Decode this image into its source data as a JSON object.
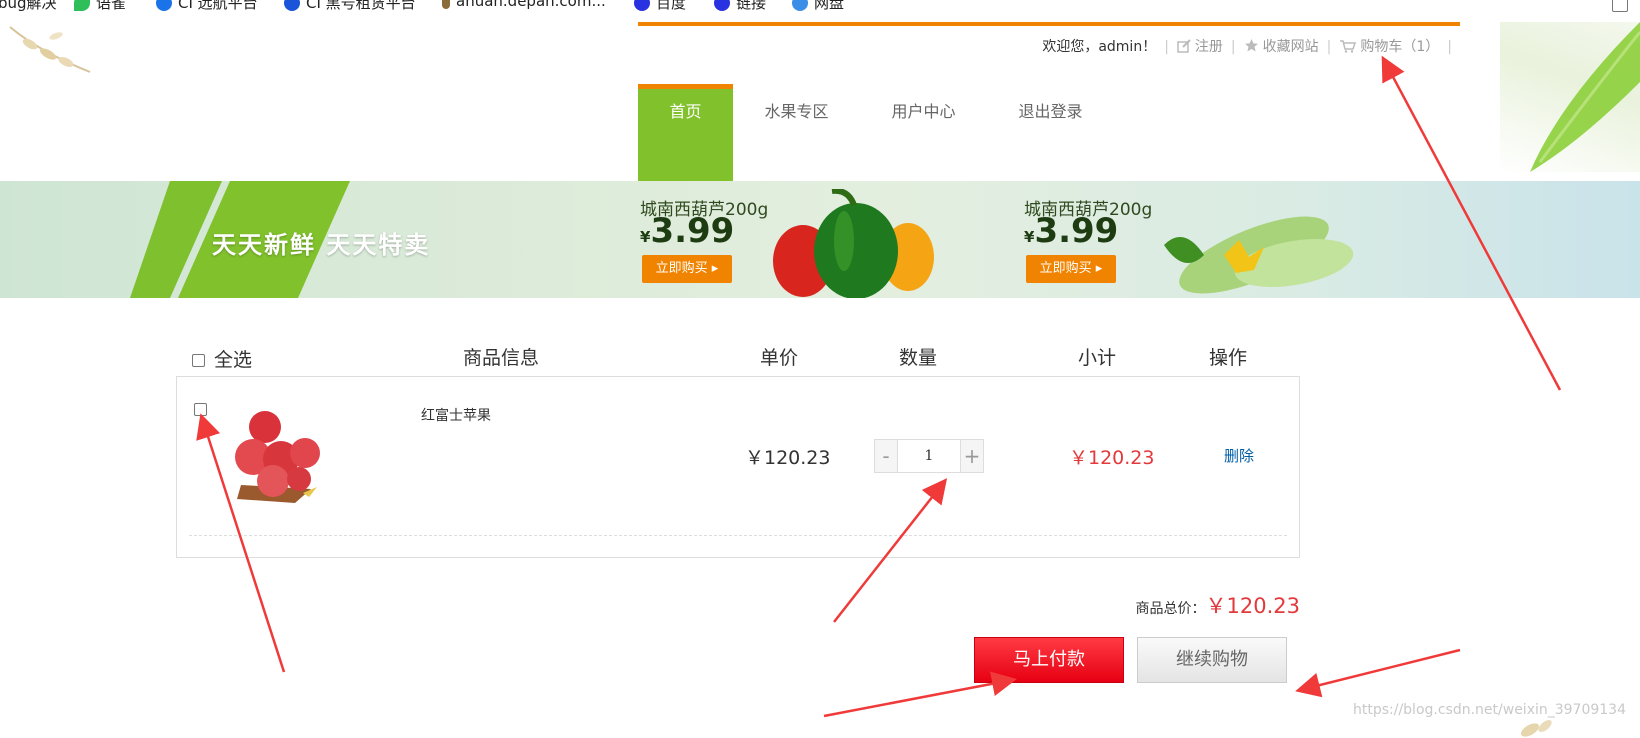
{
  "browser": {
    "bookmarks": [
      {
        "label": "bug解决",
        "color": "#3b7bd9"
      },
      {
        "label": "语雀",
        "color": "#2fbf5a"
      },
      {
        "label": "CI 远航平台",
        "color": "#1a73e8"
      },
      {
        "label": "CI 黑号租赁平台",
        "color": "#1a55d9"
      },
      {
        "label": "anuan.depan.com...",
        "color": "#8a6d3b"
      },
      {
        "label": "百度",
        "color": "#2932e1"
      },
      {
        "label": "链接",
        "color": "#2932e1"
      },
      {
        "label": "网盘",
        "color": "#3b8ee8"
      }
    ]
  },
  "header": {
    "welcome": "欢迎您，admin！",
    "register": "注册",
    "favorite": "收藏网站",
    "cart": "购物车（1）",
    "accent_color": "#f08300"
  },
  "nav": {
    "items": [
      "首页",
      "水果专区",
      "用户中心",
      "退出登录"
    ],
    "active_index": 0,
    "active_color": "#80c12c"
  },
  "banner": {
    "slogan": "天天新鲜  天天特卖",
    "promos": [
      {
        "name": "城南西葫芦200g",
        "currency": "¥",
        "price": "3.99",
        "button": "立即购买 ▸"
      },
      {
        "name": "城南西葫芦200g",
        "currency": "¥",
        "price": "3.99",
        "button": "立即购买 ▸"
      }
    ]
  },
  "cart": {
    "headers": {
      "select_all": "全选",
      "info": "商品信息",
      "unit_price": "单价",
      "quantity": "数量",
      "subtotal": "小计",
      "action": "操作"
    },
    "items": [
      {
        "name": "红富士苹果",
        "unit_price": "￥120.23",
        "quantity": "1",
        "subtotal": "￥120.23",
        "delete": "删除",
        "checked": false
      }
    ],
    "stepper": {
      "minus": "-",
      "plus": "+"
    },
    "total_label": "商品总价：",
    "total_value": "￥120.23",
    "pay_button": "马上付款",
    "continue_button": "继续购物"
  },
  "watermark": "https://blog.csdn.net/weixin_39709134"
}
